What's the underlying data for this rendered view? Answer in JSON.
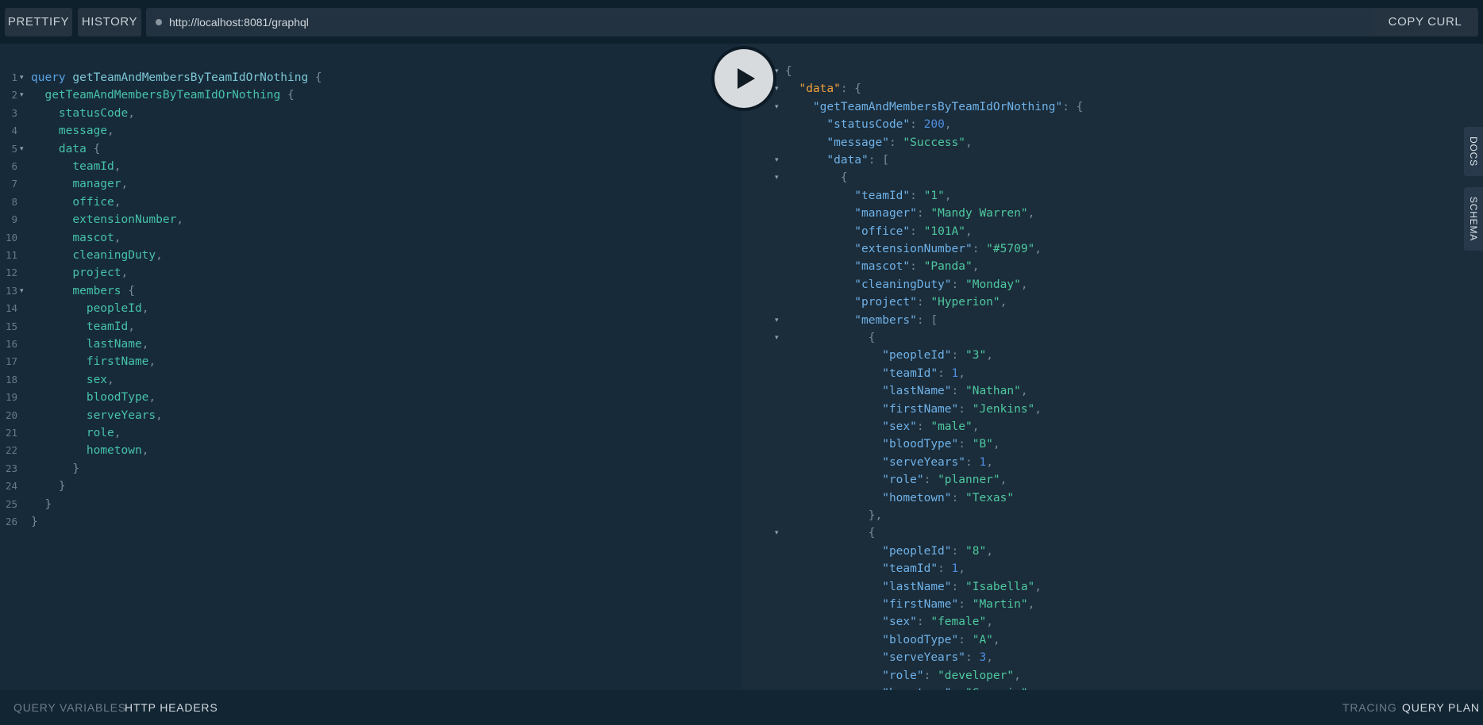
{
  "toolbar": {
    "prettify_label": "PRETTIFY",
    "history_label": "HISTORY",
    "url": "http://localhost:8081/graphql",
    "copy_curl_label": "COPY CURL"
  },
  "side_tabs": {
    "docs": "DOCS",
    "schema": "SCHEMA"
  },
  "bottom": {
    "query_variables": "QUERY VARIABLES",
    "http_headers": "HTTP HEADERS",
    "tracing": "TRACING",
    "query_plan": "QUERY PLAN"
  },
  "editor": {
    "lines": [
      {
        "n": "1",
        "fold": true,
        "tokens": [
          [
            "kw",
            "query "
          ],
          [
            "opname",
            "getTeamAndMembersByTeamIdOrNothing"
          ],
          [
            "punc",
            " {"
          ]
        ]
      },
      {
        "n": "2",
        "fold": true,
        "tokens": [
          [
            "fld",
            "  getTeamAndMembersByTeamIdOrNothing"
          ],
          [
            "punc",
            " {"
          ]
        ]
      },
      {
        "n": "3",
        "tokens": [
          [
            "fld",
            "    statusCode"
          ],
          [
            "punc",
            ","
          ]
        ]
      },
      {
        "n": "4",
        "tokens": [
          [
            "fld",
            "    message"
          ],
          [
            "punc",
            ","
          ]
        ]
      },
      {
        "n": "5",
        "fold": true,
        "tokens": [
          [
            "fld",
            "    data"
          ],
          [
            "punc",
            " {"
          ]
        ]
      },
      {
        "n": "6",
        "tokens": [
          [
            "fld",
            "      teamId"
          ],
          [
            "punc",
            ","
          ]
        ]
      },
      {
        "n": "7",
        "tokens": [
          [
            "fld",
            "      manager"
          ],
          [
            "punc",
            ","
          ]
        ]
      },
      {
        "n": "8",
        "tokens": [
          [
            "fld",
            "      office"
          ],
          [
            "punc",
            ","
          ]
        ]
      },
      {
        "n": "9",
        "tokens": [
          [
            "fld",
            "      extensionNumber"
          ],
          [
            "punc",
            ","
          ]
        ]
      },
      {
        "n": "10",
        "tokens": [
          [
            "fld",
            "      mascot"
          ],
          [
            "punc",
            ","
          ]
        ]
      },
      {
        "n": "11",
        "tokens": [
          [
            "fld",
            "      cleaningDuty"
          ],
          [
            "punc",
            ","
          ]
        ]
      },
      {
        "n": "12",
        "tokens": [
          [
            "fld",
            "      project"
          ],
          [
            "punc",
            ","
          ]
        ]
      },
      {
        "n": "13",
        "fold": true,
        "tokens": [
          [
            "fld",
            "      members"
          ],
          [
            "punc",
            " {"
          ]
        ]
      },
      {
        "n": "14",
        "tokens": [
          [
            "fld",
            "        peopleId"
          ],
          [
            "punc",
            ","
          ]
        ]
      },
      {
        "n": "15",
        "tokens": [
          [
            "fld",
            "        teamId"
          ],
          [
            "punc",
            ","
          ]
        ]
      },
      {
        "n": "16",
        "tokens": [
          [
            "fld",
            "        lastName"
          ],
          [
            "punc",
            ","
          ]
        ]
      },
      {
        "n": "17",
        "tokens": [
          [
            "fld",
            "        firstName"
          ],
          [
            "punc",
            ","
          ]
        ]
      },
      {
        "n": "18",
        "tokens": [
          [
            "fld",
            "        sex"
          ],
          [
            "punc",
            ","
          ]
        ]
      },
      {
        "n": "19",
        "tokens": [
          [
            "fld",
            "        bloodType"
          ],
          [
            "punc",
            ","
          ]
        ]
      },
      {
        "n": "20",
        "tokens": [
          [
            "fld",
            "        serveYears"
          ],
          [
            "punc",
            ","
          ]
        ]
      },
      {
        "n": "21",
        "tokens": [
          [
            "fld",
            "        role"
          ],
          [
            "punc",
            ","
          ]
        ]
      },
      {
        "n": "22",
        "tokens": [
          [
            "fld",
            "        hometown"
          ],
          [
            "punc",
            ","
          ]
        ]
      },
      {
        "n": "23",
        "tokens": [
          [
            "punc",
            "      }"
          ]
        ]
      },
      {
        "n": "24",
        "tokens": [
          [
            "punc",
            "    }"
          ]
        ]
      },
      {
        "n": "25",
        "tokens": [
          [
            "punc",
            "  }"
          ]
        ]
      },
      {
        "n": "26",
        "tokens": [
          [
            "punc",
            "}"
          ]
        ]
      }
    ]
  },
  "result": {
    "lines": [
      {
        "fold": true,
        "tokens": [
          [
            "punc",
            "{"
          ]
        ]
      },
      {
        "fold": true,
        "tokens": [
          [
            "dkey",
            "  \"data\""
          ],
          [
            "punc",
            ": {"
          ]
        ]
      },
      {
        "fold": true,
        "tokens": [
          [
            "key",
            "    \"getTeamAndMembersByTeamIdOrNothing\""
          ],
          [
            "punc",
            ": {"
          ]
        ]
      },
      {
        "tokens": [
          [
            "key",
            "      \"statusCode\""
          ],
          [
            "punc",
            ": "
          ],
          [
            "num",
            "200"
          ],
          [
            "punc",
            ","
          ]
        ]
      },
      {
        "tokens": [
          [
            "key",
            "      \"message\""
          ],
          [
            "punc",
            ": "
          ],
          [
            "str",
            "\"Success\""
          ],
          [
            "punc",
            ","
          ]
        ]
      },
      {
        "fold": true,
        "tokens": [
          [
            "key",
            "      \"data\""
          ],
          [
            "punc",
            ": ["
          ]
        ]
      },
      {
        "fold": true,
        "tokens": [
          [
            "punc",
            "        {"
          ]
        ]
      },
      {
        "tokens": [
          [
            "key",
            "          \"teamId\""
          ],
          [
            "punc",
            ": "
          ],
          [
            "str",
            "\"1\""
          ],
          [
            "punc",
            ","
          ]
        ]
      },
      {
        "tokens": [
          [
            "key",
            "          \"manager\""
          ],
          [
            "punc",
            ": "
          ],
          [
            "str",
            "\"Mandy Warren\""
          ],
          [
            "punc",
            ","
          ]
        ]
      },
      {
        "tokens": [
          [
            "key",
            "          \"office\""
          ],
          [
            "punc",
            ": "
          ],
          [
            "str",
            "\"101A\""
          ],
          [
            "punc",
            ","
          ]
        ]
      },
      {
        "tokens": [
          [
            "key",
            "          \"extensionNumber\""
          ],
          [
            "punc",
            ": "
          ],
          [
            "str",
            "\"#5709\""
          ],
          [
            "punc",
            ","
          ]
        ]
      },
      {
        "tokens": [
          [
            "key",
            "          \"mascot\""
          ],
          [
            "punc",
            ": "
          ],
          [
            "str",
            "\"Panda\""
          ],
          [
            "punc",
            ","
          ]
        ]
      },
      {
        "tokens": [
          [
            "key",
            "          \"cleaningDuty\""
          ],
          [
            "punc",
            ": "
          ],
          [
            "str",
            "\"Monday\""
          ],
          [
            "punc",
            ","
          ]
        ]
      },
      {
        "tokens": [
          [
            "key",
            "          \"project\""
          ],
          [
            "punc",
            ": "
          ],
          [
            "str",
            "\"Hyperion\""
          ],
          [
            "punc",
            ","
          ]
        ]
      },
      {
        "fold": true,
        "tokens": [
          [
            "key",
            "          \"members\""
          ],
          [
            "punc",
            ": ["
          ]
        ]
      },
      {
        "fold": true,
        "tokens": [
          [
            "punc",
            "            {"
          ]
        ]
      },
      {
        "tokens": [
          [
            "key",
            "              \"peopleId\""
          ],
          [
            "punc",
            ": "
          ],
          [
            "str",
            "\"3\""
          ],
          [
            "punc",
            ","
          ]
        ]
      },
      {
        "tokens": [
          [
            "key",
            "              \"teamId\""
          ],
          [
            "punc",
            ": "
          ],
          [
            "num",
            "1"
          ],
          [
            "punc",
            ","
          ]
        ]
      },
      {
        "tokens": [
          [
            "key",
            "              \"lastName\""
          ],
          [
            "punc",
            ": "
          ],
          [
            "str",
            "\"Nathan\""
          ],
          [
            "punc",
            ","
          ]
        ]
      },
      {
        "tokens": [
          [
            "key",
            "              \"firstName\""
          ],
          [
            "punc",
            ": "
          ],
          [
            "str",
            "\"Jenkins\""
          ],
          [
            "punc",
            ","
          ]
        ]
      },
      {
        "tokens": [
          [
            "key",
            "              \"sex\""
          ],
          [
            "punc",
            ": "
          ],
          [
            "str",
            "\"male\""
          ],
          [
            "punc",
            ","
          ]
        ]
      },
      {
        "tokens": [
          [
            "key",
            "              \"bloodType\""
          ],
          [
            "punc",
            ": "
          ],
          [
            "str",
            "\"B\""
          ],
          [
            "punc",
            ","
          ]
        ]
      },
      {
        "tokens": [
          [
            "key",
            "              \"serveYears\""
          ],
          [
            "punc",
            ": "
          ],
          [
            "num",
            "1"
          ],
          [
            "punc",
            ","
          ]
        ]
      },
      {
        "tokens": [
          [
            "key",
            "              \"role\""
          ],
          [
            "punc",
            ": "
          ],
          [
            "str",
            "\"planner\""
          ],
          [
            "punc",
            ","
          ]
        ]
      },
      {
        "tokens": [
          [
            "key",
            "              \"hometown\""
          ],
          [
            "punc",
            ": "
          ],
          [
            "str",
            "\"Texas\""
          ]
        ]
      },
      {
        "tokens": [
          [
            "punc",
            "            },"
          ]
        ]
      },
      {
        "fold": true,
        "tokens": [
          [
            "punc",
            "            {"
          ]
        ]
      },
      {
        "tokens": [
          [
            "key",
            "              \"peopleId\""
          ],
          [
            "punc",
            ": "
          ],
          [
            "str",
            "\"8\""
          ],
          [
            "punc",
            ","
          ]
        ]
      },
      {
        "tokens": [
          [
            "key",
            "              \"teamId\""
          ],
          [
            "punc",
            ": "
          ],
          [
            "num",
            "1"
          ],
          [
            "punc",
            ","
          ]
        ]
      },
      {
        "tokens": [
          [
            "key",
            "              \"lastName\""
          ],
          [
            "punc",
            ": "
          ],
          [
            "str",
            "\"Isabella\""
          ],
          [
            "punc",
            ","
          ]
        ]
      },
      {
        "tokens": [
          [
            "key",
            "              \"firstName\""
          ],
          [
            "punc",
            ": "
          ],
          [
            "str",
            "\"Martin\""
          ],
          [
            "punc",
            ","
          ]
        ]
      },
      {
        "tokens": [
          [
            "key",
            "              \"sex\""
          ],
          [
            "punc",
            ": "
          ],
          [
            "str",
            "\"female\""
          ],
          [
            "punc",
            ","
          ]
        ]
      },
      {
        "tokens": [
          [
            "key",
            "              \"bloodType\""
          ],
          [
            "punc",
            ": "
          ],
          [
            "str",
            "\"A\""
          ],
          [
            "punc",
            ","
          ]
        ]
      },
      {
        "tokens": [
          [
            "key",
            "              \"serveYears\""
          ],
          [
            "punc",
            ": "
          ],
          [
            "num",
            "3"
          ],
          [
            "punc",
            ","
          ]
        ]
      },
      {
        "tokens": [
          [
            "key",
            "              \"role\""
          ],
          [
            "punc",
            ": "
          ],
          [
            "str",
            "\"developer\""
          ],
          [
            "punc",
            ","
          ]
        ]
      },
      {
        "tokens": [
          [
            "key",
            "              \"hometown\""
          ],
          [
            "punc",
            ": "
          ],
          [
            "str",
            "\"Georgia\""
          ]
        ]
      }
    ]
  },
  "icons": {
    "run": "play-icon",
    "url_status": "dot-icon",
    "fold": "fold-arrow-icon"
  }
}
